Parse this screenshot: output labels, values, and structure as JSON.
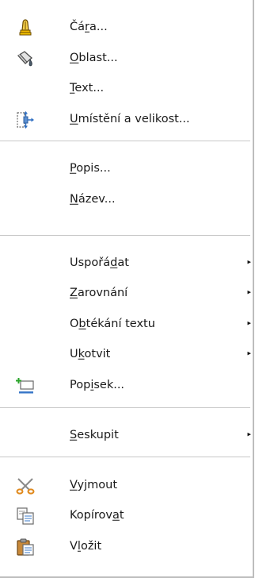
{
  "menu": {
    "items": [
      {
        "icon": "line-icon",
        "pre": "Čá",
        "mn": "r",
        "post": "a..."
      },
      {
        "icon": "area-fill-icon",
        "pre": "",
        "mn": "O",
        "post": "blast..."
      },
      {
        "icon": "",
        "pre": "",
        "mn": "T",
        "post": "ext..."
      },
      {
        "icon": "position-size-icon",
        "pre": "",
        "mn": "U",
        "post": "místění a velikost..."
      },
      {
        "icon": "",
        "pre": "",
        "mn": "P",
        "post": "opis..."
      },
      {
        "icon": "",
        "pre": "",
        "mn": "N",
        "post": "ázev..."
      },
      {
        "icon": "",
        "pre": "Uspořá",
        "mn": "d",
        "post": "at",
        "submenu": true
      },
      {
        "icon": "",
        "pre": "",
        "mn": "Z",
        "post": "arovnání",
        "submenu": true
      },
      {
        "icon": "",
        "pre": "O",
        "mn": "b",
        "post": "tékání textu",
        "submenu": true
      },
      {
        "icon": "",
        "pre": "U",
        "mn": "k",
        "post": "otvit",
        "submenu": true
      },
      {
        "icon": "insert-caption-icon",
        "pre": "Pop",
        "mn": "i",
        "post": "sek..."
      },
      {
        "icon": "",
        "pre": "",
        "mn": "S",
        "post": "eskupit",
        "submenu": true
      },
      {
        "icon": "scissors-icon",
        "pre": "",
        "mn": "V",
        "post": "yjmout"
      },
      {
        "icon": "copy-icon",
        "pre": "Kopírov",
        "mn": "a",
        "post": "t"
      },
      {
        "icon": "paste-icon",
        "pre": "V",
        "mn": "l",
        "post": "ožit"
      }
    ],
    "submenu_arrow": "▸",
    "colors": {
      "separator": "#c8c8c8",
      "text": "#1a1a1a"
    }
  }
}
